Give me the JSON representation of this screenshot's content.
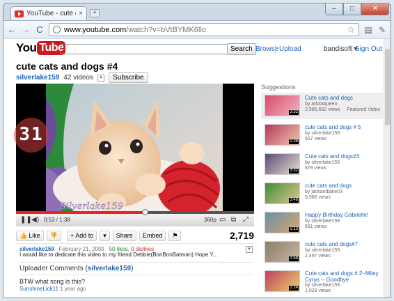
{
  "browser": {
    "tab_title": "YouTube - cute cats and...",
    "tab_close": "×",
    "new_tab": "+",
    "url_host": "www.youtube.com",
    "url_path": "/watch?v=bVtBYMK6llo",
    "back": "←",
    "forward": "→",
    "reload": "C",
    "star": "☆",
    "page_menu": "▤",
    "tools_menu": "✎",
    "win_min": "–",
    "win_max": "□",
    "win_close": "✕"
  },
  "header": {
    "logo_you": "You",
    "logo_tube": "Tube",
    "search_label": "Search",
    "browse": "Browse",
    "upload": "Upload",
    "username": "bandisoft",
    "username_arrow": "▾",
    "sign_out": "Sign Out"
  },
  "video": {
    "title": "cute cats and dogs #4",
    "uploader": "silverlake159",
    "videos_count": "42 videos",
    "subscribe": "Subscribe",
    "watermark": "Silverlake159",
    "overlay_counter": "31",
    "time": "0:53 / 1:38",
    "quality": "360p",
    "progress_fraction": 0.54,
    "view_count": "2,719"
  },
  "actions": {
    "like": "Like",
    "add_to": "Add to",
    "share": "Share",
    "embed": "Embed"
  },
  "meta": {
    "user": "silverlake159",
    "date": "February 21, 2009",
    "likes": "50 likes",
    "dislikes": "0 dislikes",
    "description": "I would like to dedicate this video to my friend Debbie(BonBonBatman) Hope Y..."
  },
  "comments": {
    "heading_prefix": "Uploader Comments (",
    "heading_user": "silverlake159",
    "heading_suffix": ")",
    "text": "BTW what song is this?",
    "author": "SunshineLick11",
    "age": "1 year ago"
  },
  "suggestions": {
    "heading": "Suggestions",
    "items": [
      {
        "title": "Cute cats and dogs",
        "by": "by arlotaqueen",
        "views": "2,585,682 views",
        "duration": "3:32",
        "featured": "Featured Video"
      },
      {
        "title": "cute cats and dogs # 5",
        "by": "by silverlake159",
        "views": "637 views",
        "duration": "1:38"
      },
      {
        "title": "Cute cats and dogs#3",
        "by": "by silverlake159",
        "views": "878 views",
        "duration": "3:32"
      },
      {
        "title": "cute cats and dogs",
        "by": "by jackandjake03",
        "views": "6,986 views",
        "duration": "3:46"
      },
      {
        "title": "Happy Birthday Gabrielle!",
        "by": "by silverlake159",
        "views": "691 views",
        "duration": "1:13"
      },
      {
        "title": "cute cats and dogs#7",
        "by": "by silverlake159",
        "views": "2,497 views",
        "duration": "1:58"
      },
      {
        "title": "Cute cats and dogs # 2~Miley Cyrus -- Goodbye",
        "by": "by silverlake159",
        "views": "1,026 views",
        "duration": "2:24"
      }
    ]
  },
  "colors": {
    "link": "#1c62b9",
    "youtube_red": "#cc181e",
    "progress": "#e22222"
  }
}
